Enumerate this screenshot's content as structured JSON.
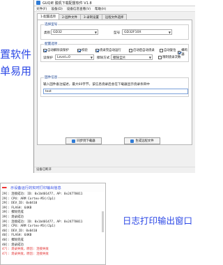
{
  "window": {
    "title": "GUQIE 脱机下载配置软件 V1.8",
    "menus": [
      "文件(F)",
      "设备(D)",
      "设备信息查看(V)",
      "帮助(H)"
    ],
    "tabs": [
      "1-配置选项",
      "2-固件文件",
      "3-录制设置",
      "远程文件选择"
    ],
    "target": {
      "group_label": "选择型号",
      "vendor_label": "类别",
      "vendor_value": "GD32",
      "chip_label": "型号",
      "chip_value": "GD32F10X"
    },
    "config": {
      "group_label": "配置选项",
      "checks": [
        {
          "label": "自动解除读保护",
          "checked": true
        },
        {
          "label": "校验",
          "checked": true
        },
        {
          "label": "烧录完自动运行",
          "checked": true
        },
        {
          "label": "启动后自动烧录",
          "checked": false
        },
        {
          "label": "自动复位",
          "checked": false
        },
        {
          "label": "蜂鸣器",
          "checked": true
        }
      ],
      "read_protect_label": "读保护",
      "read_protect_value": "Level=0",
      "erase_label": "擦除方式",
      "erase_value": "擦除全片",
      "limit_label": "限制烧录次数"
    },
    "firmware": {
      "group_label": "固件信息",
      "hint": "输入固件备注描述，最大60字节，该信息烧录后会在下载器显示烧录条目中",
      "value": "test"
    },
    "buttons": {
      "download": "同步到下载器",
      "save": "生成远程文件"
    },
    "status": "设备已断开"
  },
  "overlay": {
    "line1": "置软件",
    "line2": "单易用"
  },
  "log": {
    "header": "示设备运行的实时打印输出信息",
    "lines": [
      {
        "text": "29]: 连接成功: ID: 0x1b401477, AP: 0x24770011",
        "err": false
      },
      {
        "text": "29]: CPU: ARM Cortex-M3(r2p1)",
        "err": false
      },
      {
        "text": "29]: DEV_ID: 0x0410",
        "err": false
      },
      {
        "text": "39]: FLASH: 64KB",
        "err": false
      },
      {
        "text": "39]: 擦除完成",
        "err": false
      },
      {
        "text": "39]: 烧录成功",
        "err": false
      },
      {
        "text": "39]: 连接成功: ID: 0x1b401477, AP: 0x24770011",
        "err": false
      },
      {
        "text": "39]: CPU: ARM Cortex-M3(r2p1)",
        "err": false
      },
      {
        "text": "40]: DEV_ID: 0x0410",
        "err": false
      },
      {
        "text": "40]: FLASH: 64KB",
        "err": false
      },
      {
        "text": "40]: 擦除完成",
        "err": false
      },
      {
        "text": "40]: 烧录成功",
        "err": false
      },
      {
        "text": "47]: 烧录失败，原因: 连接失败",
        "err": true
      },
      {
        "text": "47]: 烧录失败，原因: 连接失败",
        "err": true
      }
    ]
  },
  "caption": "日志打印输出窗口",
  "colors": {
    "accent": "#2d49e6",
    "error": "#e02828"
  }
}
